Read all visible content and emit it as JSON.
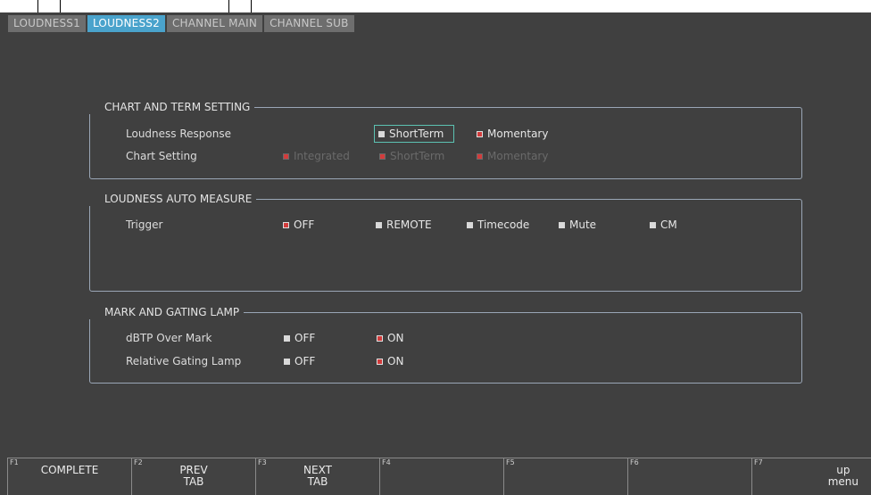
{
  "tabs": [
    {
      "label": "LOUDNESS1",
      "active": false
    },
    {
      "label": "LOUDNESS2",
      "active": true
    },
    {
      "label": "CHANNEL MAIN",
      "active": false
    },
    {
      "label": "CHANNEL SUB",
      "active": false
    }
  ],
  "chart_term": {
    "title": "CHART AND TERM SETTING",
    "loudness_response": {
      "label": "Loudness Response",
      "options": [
        {
          "label": "ShortTerm",
          "checked": false
        },
        {
          "label": "Momentary",
          "checked": true
        }
      ]
    },
    "chart_setting": {
      "label": "Chart Setting",
      "options": [
        {
          "label": "Integrated",
          "checked": true,
          "disabled": true
        },
        {
          "label": "ShortTerm",
          "checked": true,
          "disabled": true
        },
        {
          "label": "Momentary",
          "checked": true,
          "disabled": true
        }
      ]
    }
  },
  "auto_measure": {
    "title": "LOUDNESS AUTO MEASURE",
    "trigger": {
      "label": "Trigger",
      "options": [
        {
          "label": "OFF",
          "checked": true
        },
        {
          "label": "REMOTE",
          "checked": false
        },
        {
          "label": "Timecode",
          "checked": false
        },
        {
          "label": "Mute",
          "checked": false
        },
        {
          "label": "CM",
          "checked": false
        }
      ]
    }
  },
  "mark_gating": {
    "title": "MARK AND GATING LAMP",
    "dbtp": {
      "label": "dBTP Over Mark",
      "options": [
        {
          "label": "OFF",
          "checked": false
        },
        {
          "label": "ON",
          "checked": true
        }
      ]
    },
    "relative_gating": {
      "label": "Relative Gating Lamp",
      "options": [
        {
          "label": "OFF",
          "checked": false
        },
        {
          "label": "ON",
          "checked": true
        }
      ]
    }
  },
  "fkeys": [
    {
      "num": "F1",
      "label": "COMPLETE"
    },
    {
      "num": "F2",
      "label": "PREV\nTAB"
    },
    {
      "num": "F3",
      "label": "NEXT\nTAB"
    },
    {
      "num": "F4",
      "label": ""
    },
    {
      "num": "F5",
      "label": ""
    },
    {
      "num": "F6",
      "label": ""
    },
    {
      "num": "F7",
      "label": "up\nmenu"
    }
  ],
  "colors": {
    "background": "#404040",
    "active_tab": "#4aa3cc",
    "checked_mark": "#d23c3c",
    "focus_border": "#5cc2b2",
    "group_border": "#9aa6b6"
  }
}
